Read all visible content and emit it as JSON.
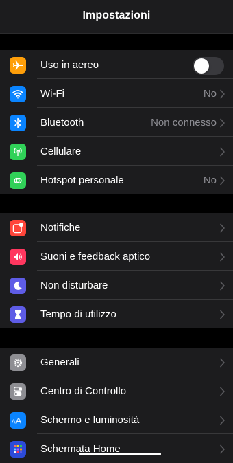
{
  "header": {
    "title": "Impostazioni"
  },
  "colors": {
    "background": "#000000",
    "cell_background": "#1c1c1e",
    "separator": "#38383a",
    "secondary_text": "#8d8d93"
  },
  "groups": [
    {
      "items": [
        {
          "label": "Uso in aereo",
          "icon": "airplane-icon",
          "icon_color": "#ff9f0a",
          "toggle_on": false
        },
        {
          "label": "Wi-Fi",
          "value": "No",
          "icon": "wifi-icon",
          "icon_color": "#0a84ff"
        },
        {
          "label": "Bluetooth",
          "value": "Non connesso",
          "icon": "bluetooth-icon",
          "icon_color": "#0a84ff"
        },
        {
          "label": "Cellulare",
          "icon": "cellular-icon",
          "icon_color": "#30d158"
        },
        {
          "label": "Hotspot personale",
          "value": "No",
          "icon": "hotspot-icon",
          "icon_color": "#30d158"
        }
      ]
    },
    {
      "items": [
        {
          "label": "Notifiche",
          "icon": "notifications-icon",
          "icon_color": "#ff453a"
        },
        {
          "label": "Suoni e feedback aptico",
          "icon": "sound-icon",
          "icon_color": "#ff375f"
        },
        {
          "label": "Non disturbare",
          "icon": "moon-icon",
          "icon_color": "#5e5ce6"
        },
        {
          "label": "Tempo di utilizzo",
          "icon": "hourglass-icon",
          "icon_color": "#5e5ce6"
        }
      ]
    },
    {
      "items": [
        {
          "label": "Generali",
          "icon": "gear-icon",
          "icon_color": "#8e8e93"
        },
        {
          "label": "Centro di Controllo",
          "icon": "control-center-icon",
          "icon_color": "#8e8e93"
        },
        {
          "label": "Schermo e luminosità",
          "icon": "display-icon",
          "icon_color": "#0a84ff",
          "icon_text": "AA"
        },
        {
          "label": "Schermata Home",
          "icon": "home-screen-icon",
          "icon_color": "#2c4bd8"
        }
      ]
    }
  ]
}
